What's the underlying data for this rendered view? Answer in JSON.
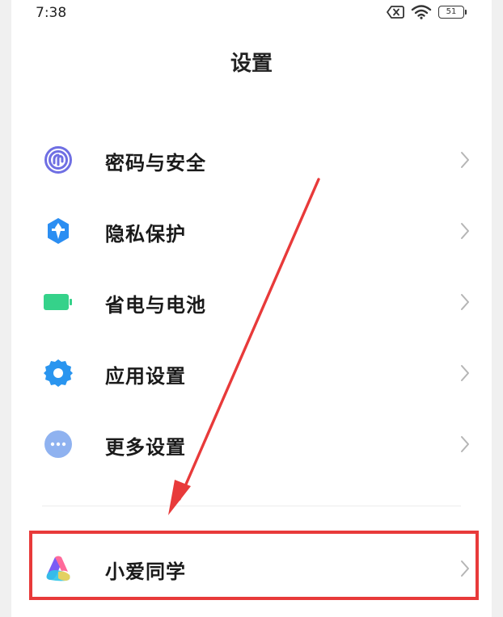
{
  "status_bar": {
    "time": "7:38",
    "battery_level": "51",
    "icons": [
      "sim-disabled-icon",
      "wifi-icon",
      "battery-icon"
    ]
  },
  "header": {
    "title": "设置"
  },
  "menu": {
    "items": [
      {
        "label": "密码与安全",
        "icon": "fingerprint-icon",
        "color": "#6f6fe3"
      },
      {
        "label": "隐私保护",
        "icon": "privacy-shield-icon",
        "color": "#2b8ef2"
      },
      {
        "label": "省电与电池",
        "icon": "battery-icon",
        "color": "#35d28a"
      },
      {
        "label": "应用设置",
        "icon": "gear-icon",
        "color": "#2a95ef"
      },
      {
        "label": "更多设置",
        "icon": "more-dots-icon",
        "color": "#8fb2f0"
      }
    ],
    "assistant": {
      "label": "小爱同学",
      "icon": "xiaoai-assistant-icon"
    }
  },
  "annotation": {
    "highlight_color": "#e83a3a",
    "arrow_color": "#e83a3a"
  }
}
